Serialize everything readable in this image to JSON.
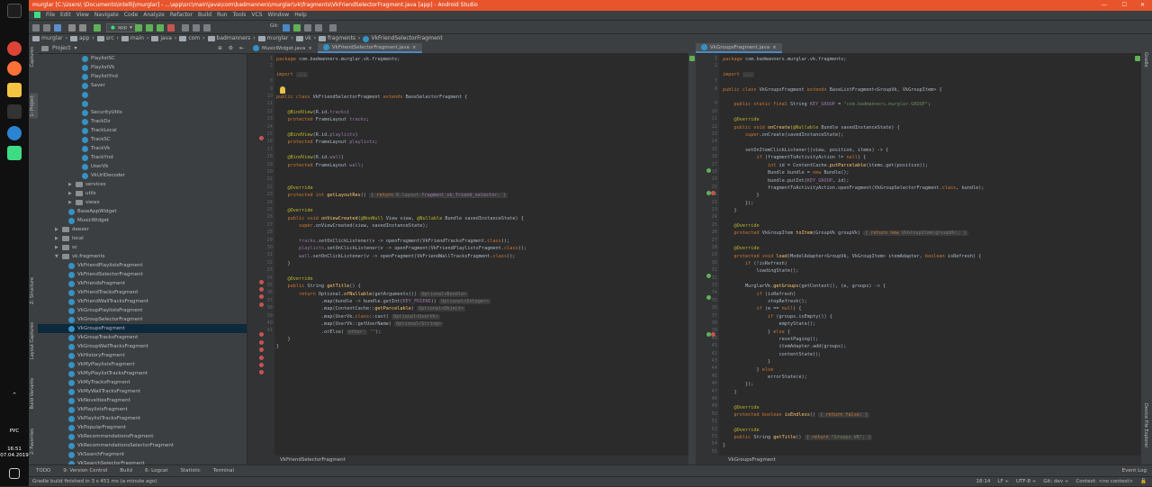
{
  "window": {
    "title": "murglar [C:\\Users\\           \\Documents\\intellij\\murglar] - ...\\app\\src\\main\\java\\com\\badmanners\\murglar\\vk\\fragments\\VkFriendSelectorFragment.java [app] - Android Studio"
  },
  "menu": [
    "File",
    "Edit",
    "View",
    "Navigate",
    "Code",
    "Analyze",
    "Refactor",
    "Build",
    "Run",
    "Tools",
    "VCS",
    "Window",
    "Help"
  ],
  "toolbar": {
    "config": "app",
    "git_label": "Git:"
  },
  "breadcrumbs": [
    "murglar",
    "app",
    "src",
    "main",
    "java",
    "com",
    "badmanners",
    "murglar",
    "vk",
    "fragments",
    "VkFriendSelectorFragment"
  ],
  "taskbar": {
    "time": "16:51",
    "date": "07.04.2019",
    "lang": "РУС"
  },
  "left_strip": {
    "project": "1: Project",
    "captures": "Captures",
    "structure": "Z: Structure",
    "layout_captures": "Layout Captures",
    "build_variants": "Build Variants",
    "favorites": "2: Favorites"
  },
  "right_strip": {
    "gradle": "Gradle",
    "device_explorer": "Device File Explorer"
  },
  "project_panel": {
    "title": "Project",
    "items": [
      {
        "label": "PlaylistSC",
        "kind": "class",
        "indent": 3
      },
      {
        "label": "PlaylistVk",
        "kind": "class",
        "indent": 3
      },
      {
        "label": "PlaylistYnd",
        "kind": "class",
        "indent": 3
      },
      {
        "label": "Saver",
        "kind": "class",
        "indent": 3
      },
      {
        "label": "",
        "kind": "class",
        "indent": 3
      },
      {
        "label": "",
        "kind": "class",
        "indent": 3
      },
      {
        "label": "SecurityUtils",
        "kind": "class",
        "indent": 3
      },
      {
        "label": "TrackDz",
        "kind": "class",
        "indent": 3
      },
      {
        "label": "TrackLocal",
        "kind": "class",
        "indent": 3
      },
      {
        "label": "TrackSC",
        "kind": "class",
        "indent": 3
      },
      {
        "label": "TrackVk",
        "kind": "class",
        "indent": 3
      },
      {
        "label": "TrackYnd",
        "kind": "class",
        "indent": 3
      },
      {
        "label": "UserVk",
        "kind": "class",
        "indent": 3
      },
      {
        "label": "VkUrlDecoder",
        "kind": "class",
        "indent": 3
      },
      {
        "label": "services",
        "kind": "folder",
        "indent": 2
      },
      {
        "label": "utils",
        "kind": "folder",
        "indent": 2
      },
      {
        "label": "views",
        "kind": "folder",
        "indent": 2
      },
      {
        "label": "BaseAppWidget",
        "kind": "class",
        "indent": 2
      },
      {
        "label": "MusicWidget",
        "kind": "class",
        "indent": 2
      },
      {
        "label": "deezer",
        "kind": "folder",
        "indent": 1
      },
      {
        "label": "local",
        "kind": "folder",
        "indent": 1
      },
      {
        "label": "sc",
        "kind": "folder",
        "indent": 1
      },
      {
        "label": "vk.fragments",
        "kind": "folder-open",
        "indent": 1
      },
      {
        "label": "VkFriendPlaylistsFragment",
        "kind": "class",
        "indent": 2
      },
      {
        "label": "VkFriendSelectorFragment",
        "kind": "class",
        "indent": 2
      },
      {
        "label": "VkFriendsFragment",
        "kind": "class",
        "indent": 2
      },
      {
        "label": "VkFriendTracksFragment",
        "kind": "class",
        "indent": 2
      },
      {
        "label": "VkFriendWallTracksFragment",
        "kind": "class",
        "indent": 2
      },
      {
        "label": "VkGroupPlaylistsFragment",
        "kind": "class",
        "indent": 2
      },
      {
        "label": "VkGroupSelectorFragment",
        "kind": "class",
        "indent": 2
      },
      {
        "label": "VkGroupsFragment",
        "kind": "class",
        "indent": 2,
        "selected": true
      },
      {
        "label": "VkGroupTracksFragment",
        "kind": "class",
        "indent": 2
      },
      {
        "label": "VkGroupWallTracksFragment",
        "kind": "class",
        "indent": 2
      },
      {
        "label": "VkHistoryFragment",
        "kind": "class",
        "indent": 2
      },
      {
        "label": "VkMyPlaylistsFragment",
        "kind": "class",
        "indent": 2
      },
      {
        "label": "VkMyPlaylistTracksFragment",
        "kind": "class",
        "indent": 2
      },
      {
        "label": "VkMyTracksFragment",
        "kind": "class",
        "indent": 2
      },
      {
        "label": "VkMyWallTracksFragment",
        "kind": "class",
        "indent": 2
      },
      {
        "label": "VkNoveltiesFragment",
        "kind": "class",
        "indent": 2
      },
      {
        "label": "VkPlaylistsFragment",
        "kind": "class",
        "indent": 2
      },
      {
        "label": "VkPlaylistTracksFragment",
        "kind": "class",
        "indent": 2
      },
      {
        "label": "VkPopularFragment",
        "kind": "class",
        "indent": 2
      },
      {
        "label": "VkRecommendationsFragment",
        "kind": "class",
        "indent": 2
      },
      {
        "label": "VkRecommendationsSelectorFragment",
        "kind": "class",
        "indent": 2
      },
      {
        "label": "VkSearchFragment",
        "kind": "class",
        "indent": 2
      },
      {
        "label": "VkSearchSelectorFragment",
        "kind": "class",
        "indent": 2
      }
    ]
  },
  "editor_left": {
    "tabs": [
      {
        "label": "MusicWidget.java",
        "active": false
      },
      {
        "label": "VkFriendSelectorFragment.java",
        "active": true
      }
    ],
    "footer": "VkFriendSelectorFragment",
    "line_numbers": [
      "1",
      "2",
      "",
      "8",
      "9",
      "10",
      "11",
      "12",
      "13",
      "14",
      "15",
      "16",
      "17",
      "18",
      "19",
      "20",
      "21",
      "22",
      "23",
      "24",
      "25",
      "26",
      "27",
      "28",
      "29",
      "30",
      "31",
      "32",
      "33",
      "34",
      "35",
      "36",
      "37",
      "38",
      "39",
      "40",
      "41"
    ]
  },
  "editor_right": {
    "tabs": [
      {
        "label": "VkGroupsFragment.java",
        "active": true
      }
    ],
    "footer": "VkGroupsFragment",
    "line_numbers": [
      "1",
      "2",
      "",
      "7",
      "8",
      "",
      "9",
      "10",
      "11",
      "12",
      "13",
      "14",
      "15",
      "16",
      "17",
      "18",
      "19",
      "20",
      "21",
      "22",
      "23",
      "24",
      "25",
      "26",
      "27",
      "28",
      "29",
      "30",
      "31",
      "32",
      "33",
      "34",
      "35",
      "36",
      "37",
      "38",
      "39",
      "40",
      "41",
      "42",
      "43",
      "44",
      "45",
      "46",
      "47",
      "48",
      "49",
      "50",
      "51",
      "52",
      "53",
      "54",
      "55",
      "56",
      "57"
    ]
  },
  "bottom_tools": [
    "TODO",
    "9: Version Control",
    "Build",
    "6: Logcat",
    "Statistic",
    "Terminal"
  ],
  "event_log": "Event Log",
  "statusbar": {
    "message": "Gradle build finished in 3 s 451 ms (a minute ago)",
    "position": "18:14",
    "line_sep": "LF ÷",
    "encoding": "UTF-8 ÷",
    "git": "Git: dev ÷",
    "context": "Context: <no context>"
  },
  "code_left": [
    "<span class=\"kw\">package</span> com.badmanners.murglar.vk.fragments;",
    "",
    "<span class=\"kw\">import</span> <span class=\"hint\">...</span>",
    "",
    "",
    "<span class=\"kw\">public class</span> VkFriendSelectorFragment <span class=\"kw\">extends</span> BaseSelectorFragment {",
    "",
    "    <span class=\"an\">@BindView</span>(R.id.<span class=\"fl\">tracks</span>)",
    "    <span class=\"kw\">protected</span> FrameLayout <span class=\"fl\">tracks</span>;",
    "",
    "    <span class=\"an\">@BindView</span>(R.id.<span class=\"fl\">playlists</span>)",
    "    <span class=\"kw\">protected</span> FrameLayout <span class=\"fl\">playlists</span>;",
    "",
    "    <span class=\"an\">@BindView</span>(R.id.<span class=\"fl\">wall</span>)",
    "    <span class=\"kw\">protected</span> FrameLayout <span class=\"fl\">wall</span>;",
    "",
    "",
    "    <span class=\"an\">@Override</span>",
    "    <span class=\"kw\">protected int</span> <span class=\"fn\">getLayoutRes</span>() <span class=\"hint\">{ <span class=\"kw\">return</span> R.layout.<span class=\"fl\">fragment_vk_friend_selector</span>; }</span>",
    "",
    "    <span class=\"an\">@Override</span>",
    "    <span class=\"kw\">public void</span> <span class=\"fn\">onViewCreated</span>(<span class=\"an\">@NonNull</span> View view, <span class=\"an\">@Nullable</span> Bundle savedInstanceState) {",
    "        <span class=\"kw\">super</span>.onViewCreated(view, savedInstanceState);",
    "",
    "        <span class=\"fl\">tracks</span>.setOnClickListener(v -> openFragment(VkFriendTracksFragment.<span class=\"kw\">class</span>));",
    "        <span class=\"fl\">playlists</span>.setOnClickListener(v -> openFragment(VkFriendPlaylistsFragment.<span class=\"kw\">class</span>));",
    "        <span class=\"fl\">wall</span>.setOnClickListener(v -> openFragment(VkFriendWallTracksFragment.<span class=\"kw\">class</span>));",
    "    }",
    "",
    "    <span class=\"an\">@Override</span>",
    "    <span class=\"kw\">public</span> String <span class=\"fn\">getTitle</span>() {",
    "        <span class=\"kw\">return</span> Optional.<span class=\"fn\">ofNullable</span>(getArguments()) <span class=\"hint\">Optional&lt;Bundle&gt;</span>",
    "                .map(bundle -> bundle.getInt(<span class=\"fl\">KEY_FRIEND</span>)) <span class=\"hint\">Optional&lt;Integer&gt;</span>",
    "                .map(ContentCache::<span class=\"fn\">getParcelable</span>) <span class=\"hint\">Optional&lt;Object&gt;</span>",
    "                .map(UserVk.<span class=\"kw\">class</span>::cast) <span class=\"hint\">Optional&lt;UserVk&gt;</span>",
    "                .map(UserVk::getUserName) <span class=\"hint\">Optional&lt;String&gt;</span>",
    "                .orElse( <span class=\"hint\">other:</span> <span class=\"st\">\"\"</span>);",
    "    }",
    "}"
  ],
  "code_right": [
    "<span class=\"kw\">package</span> com.badmanners.murglar.vk.fragments;",
    "",
    "<span class=\"kw\">import</span> <span class=\"hint\">...</span>",
    "",
    "<span class=\"kw\">public class</span> VkGroupsFragment <span class=\"kw\">extends</span> BaseListFragment&lt;GroupVk, VkGroupItem&gt; {",
    "",
    "    <span class=\"kw\">public static final</span> String <span class=\"fl\">KEY_GROUP</span> = <span class=\"st\">\"com.badmanners.murglar.GROUP\"</span>;",
    "",
    "    <span class=\"an\">@Override</span>",
    "    <span class=\"kw\">public void</span> <span class=\"fn\">onCreate</span>(<span class=\"an\">@Nullable</span> Bundle savedInstanceState) {",
    "        <span class=\"kw\">super</span>.onCreate(savedInstanceState);",
    "",
    "        setOnItemClickListener((view, position, items) -> {",
    "            <span class=\"kw\">if</span> (fragmentToActivityAction != <span class=\"kw\">null</span>) {",
    "                <span class=\"kw\">int</span> id = ContentCache.<span class=\"fn\">putParcelable</span>(items.get(position));",
    "                Bundle bundle = <span class=\"kw\">new</span> Bundle();",
    "                bundle.putInt(<span class=\"fl\">KEY_GROUP</span>, id);",
    "                fragmentToActivityAction.openFragment(VkGroupSelectorFragment.<span class=\"kw\">class</span>, bundle);",
    "            }",
    "        });",
    "    }",
    "",
    "    <span class=\"an\">@Override</span>",
    "    <span class=\"kw\">protected</span> VkGroupItem <span class=\"fn\">toItem</span>(GroupVk groupVk) <span class=\"hint\">{ <span class=\"kw\">return new</span> VkGroupItem(groupVk); }</span>",
    "",
    "    <span class=\"an\">@Override</span>",
    "    <span class=\"kw\">protected void</span> <span class=\"fn\">load</span>(ModelAdapter&lt;GroupVk, VkGroupItem&gt; itemAdapter, <span class=\"kw\">boolean</span> isRefresh) {",
    "        <span class=\"kw\">if</span> (!isRefresh)",
    "            loadingState();",
    "",
    "        MurglarVk.<span class=\"fn\">getGroups</span>(getContext(), (e, groups) -> {",
    "            <span class=\"kw\">if</span> (isRefresh)",
    "                stopRefresh();",
    "            <span class=\"kw\">if</span> (e == <span class=\"kw\">null</span>) {",
    "                <span class=\"kw\">if</span> (groups.isEmpty()) {",
    "                    emptyState();",
    "                } <span class=\"kw\">else</span> {",
    "                    resetPaging();",
    "                    itemAdapter.add(groups);",
    "                    contentState();",
    "                }",
    "            } <span class=\"kw\">else</span>",
    "                errorState(e);",
    "        });",
    "    }",
    "",
    "    <span class=\"an\">@Override</span>",
    "    <span class=\"kw\">protected boolean</span> <span class=\"fn\">isEndless</span>() <span class=\"hint\">{ <span class=\"kw\">return false</span>; }</span>",
    "",
    "    <span class=\"an\">@Override</span>",
    "    <span class=\"kw\">public</span> String <span class=\"fn\">getTitle</span>() <span class=\"hint\">{ <span class=\"kw\">return</span> <span class=\"st\">\"Groups VK\"</span>; }</span>",
    "}"
  ]
}
